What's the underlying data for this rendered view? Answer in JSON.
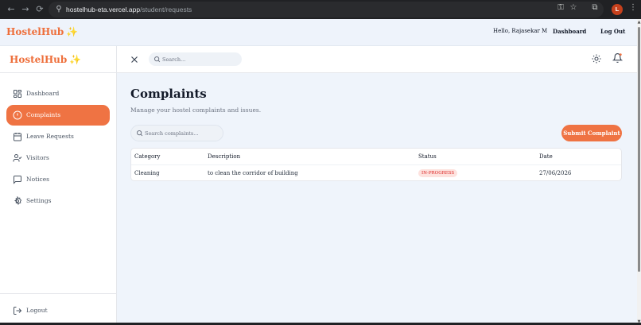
{
  "browser": {
    "url_host": "hostelhub-eta.vercel.app",
    "url_path": "/student/requests",
    "profile_initial": "L"
  },
  "site_header": {
    "brand": "HostelHub",
    "brand_icon": "✨",
    "greeting": "Hello, Rajasekar M",
    "dashboard_link": "Dashboard",
    "logout_link": "Log Out"
  },
  "sidebar": {
    "brand": "HostelHub",
    "brand_icon": "✨",
    "items": [
      {
        "label": "Dashboard",
        "icon": "dashboard-icon"
      },
      {
        "label": "Complaints",
        "icon": "alert-circle-icon",
        "active": true
      },
      {
        "label": "Leave Requests",
        "icon": "calendar-icon"
      },
      {
        "label": "Visitors",
        "icon": "user-check-icon"
      },
      {
        "label": "Notices",
        "icon": "message-square-icon"
      },
      {
        "label": "Settings",
        "icon": "settings-icon"
      }
    ],
    "logout": "Logout"
  },
  "topbar": {
    "search_placeholder": "Search..."
  },
  "main": {
    "title": "Complaints",
    "subtitle": "Manage your hostel complaints and issues.",
    "search_placeholder": "Search complaints...",
    "submit_button": "Submit Complaint",
    "table": {
      "headers": [
        "Category",
        "Description",
        "Status",
        "Date"
      ],
      "rows": [
        {
          "category": "Cleaning",
          "description": "to clean the corridor of building",
          "status": "IN-PROGRESS",
          "date": "27/06/2026"
        }
      ]
    }
  },
  "colors": {
    "accent": "#ef7343",
    "brand": "#ee6e3a",
    "status_in_progress_bg": "#fde2de",
    "status_in_progress_text": "#dc2626"
  }
}
